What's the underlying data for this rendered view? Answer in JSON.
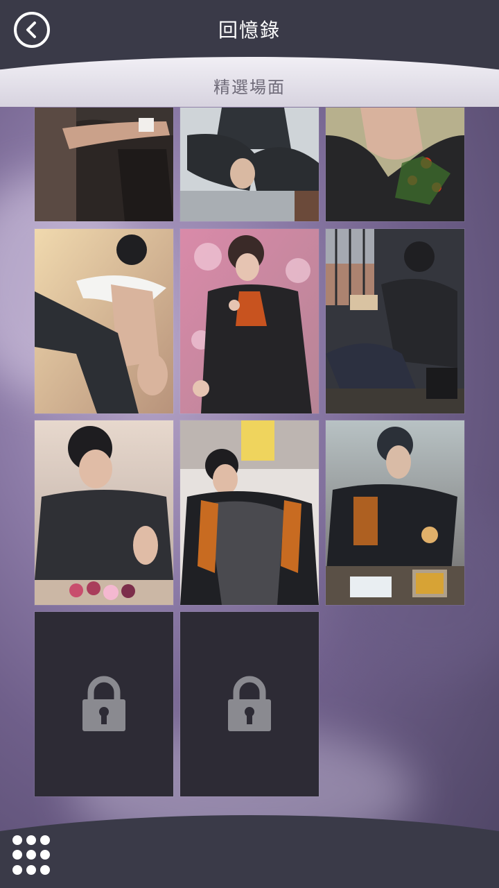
{
  "header": {
    "title": "回憶錄",
    "back_icon": "back-arrow-icon"
  },
  "section": {
    "label": "精選場面"
  },
  "gallery": {
    "items": [
      {
        "id": "scene-1",
        "status": "unlocked",
        "theme": "dark-folded-arms"
      },
      {
        "id": "scene-2",
        "status": "unlocked",
        "theme": "sitting-on-bed"
      },
      {
        "id": "scene-3",
        "status": "unlocked",
        "theme": "neck-with-plant"
      },
      {
        "id": "scene-4",
        "status": "unlocked",
        "theme": "kick-pose"
      },
      {
        "id": "scene-5",
        "status": "unlocked",
        "theme": "holding-candy"
      },
      {
        "id": "scene-6",
        "status": "unlocked",
        "theme": "reading-by-window"
      },
      {
        "id": "scene-7",
        "status": "unlocked",
        "theme": "strings-and-gems"
      },
      {
        "id": "scene-8",
        "status": "unlocked",
        "theme": "lying-with-card"
      },
      {
        "id": "scene-9",
        "status": "unlocked",
        "theme": "crafting-at-table"
      },
      {
        "id": "scene-10",
        "status": "locked",
        "theme": "lock-icon"
      },
      {
        "id": "scene-11",
        "status": "locked",
        "theme": "lock-icon"
      }
    ]
  },
  "footer": {
    "menu_icon": "grid-menu-icon"
  },
  "colors": {
    "bar": "#3a3a48",
    "locked_tile": "#2d2b35",
    "lock_gray": "#8a8a90"
  }
}
